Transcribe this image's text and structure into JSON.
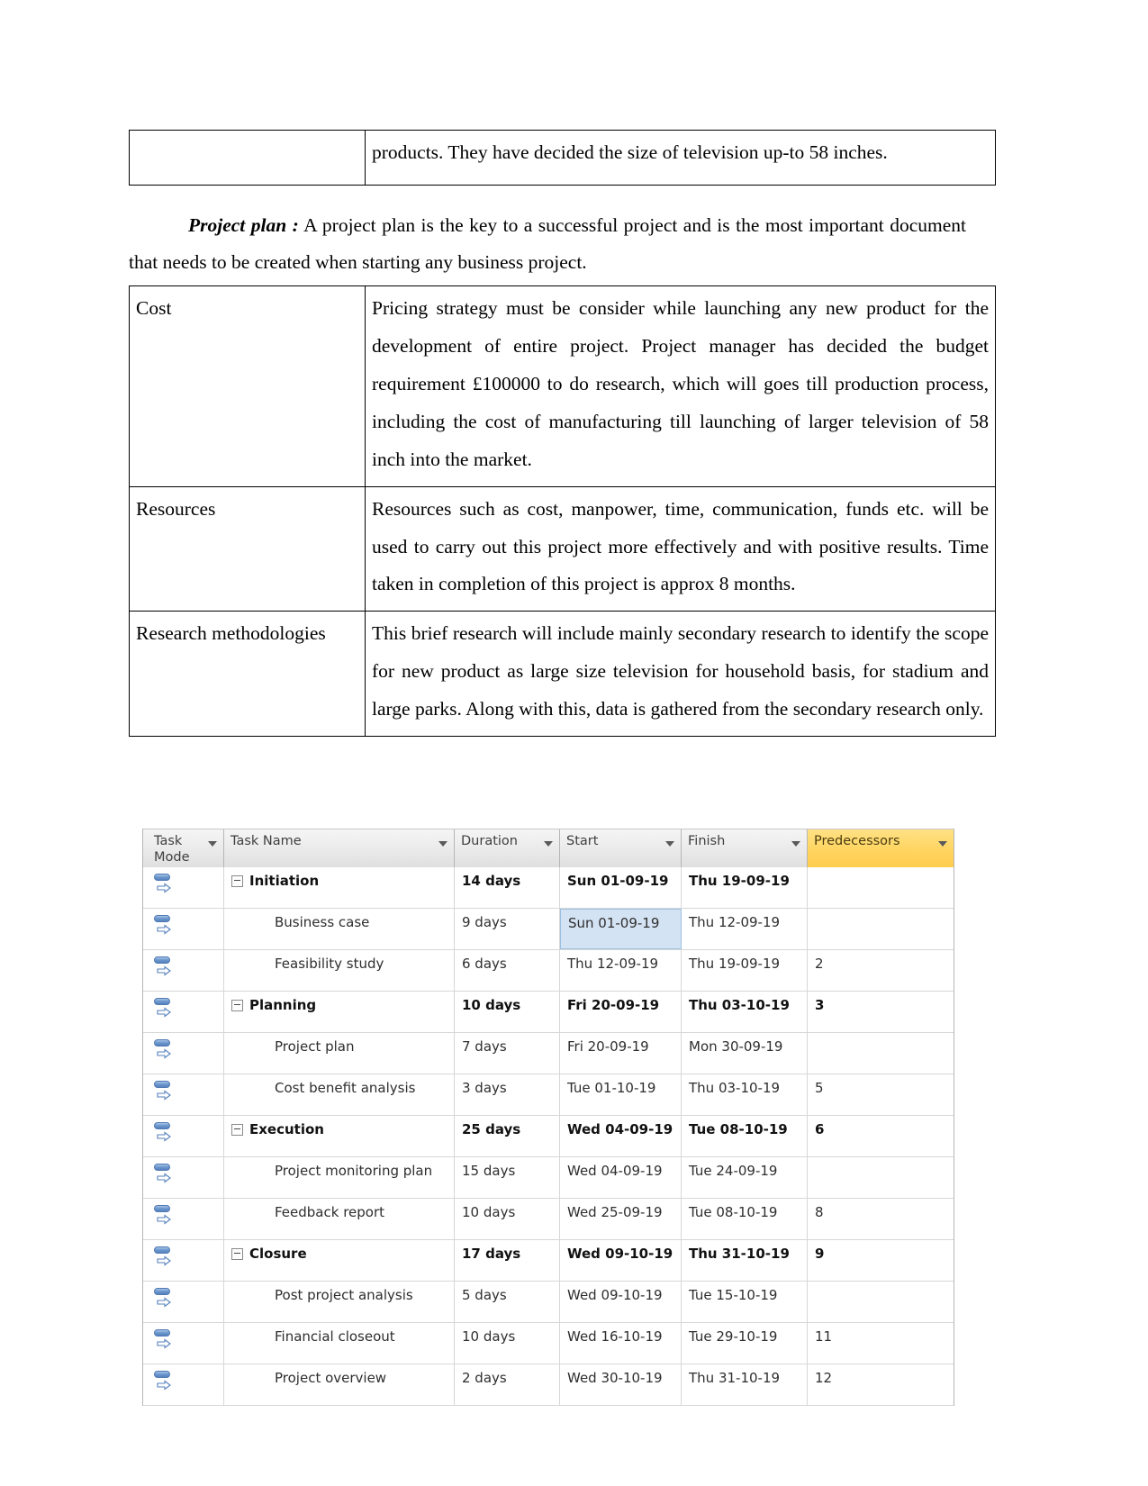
{
  "document": {
    "top_table": {
      "left_cell": "",
      "right_cell": "products. They have decided the size of television up-to 58 inches."
    },
    "intro_paragraph": {
      "heading": "Project plan :",
      "text": " A project plan is the key to a successful project and is the most important document that needs to be created when starting any business project."
    },
    "plan_table": {
      "rows": [
        {
          "label": "Cost",
          "body": "Pricing strategy must be consider while launching any new product for the development of entire project. Project manager has decided the budget requirement  £100000 to do research, which will goes till production process, including the cost of manufacturing till launching of larger television of 58 inch into the market."
        },
        {
          "label": "Resources",
          "body": "Resources such as cost, manpower, time, communication, funds etc. will be used to carry out this project more effectively and with positive results. Time taken in completion of this project is approx 8 months."
        },
        {
          "label": "Research methodologies",
          "body": "This brief research will include mainly secondary research to identify the scope for new product as large size television for household basis, for stadium and large parks. Along with this, data is gathered from the secondary research only."
        }
      ]
    }
  },
  "project_grid": {
    "columns": [
      {
        "key": "task_mode",
        "label": "Task Mode",
        "filter_icon": "chevron-down-icon",
        "highlighted": false
      },
      {
        "key": "task_name",
        "label": "Task Name",
        "filter_icon": "chevron-down-icon",
        "highlighted": false
      },
      {
        "key": "duration",
        "label": "Duration",
        "filter_icon": "chevron-down-icon",
        "highlighted": false
      },
      {
        "key": "start",
        "label": "Start",
        "filter_icon": "chevron-down-icon",
        "highlighted": false
      },
      {
        "key": "finish",
        "label": "Finish",
        "filter_icon": "chevron-down-icon",
        "highlighted": false
      },
      {
        "key": "predecessors",
        "label": "Predecessors",
        "filter_icon": "chevron-down-icon",
        "highlighted": true
      }
    ],
    "accent_color": "#ffd45e",
    "selection_color": "#d4e3f3",
    "mode_icon": "auto-schedule-icon",
    "rows": [
      {
        "task_mode": "auto-schedule-icon",
        "name": "Initiation",
        "duration": "14 days",
        "start": "Sun 01-09-19",
        "finish": "Thu 19-09-19",
        "predecessors": "",
        "summary": true,
        "level": 0,
        "selected_cell": ""
      },
      {
        "task_mode": "auto-schedule-icon",
        "name": "Business case",
        "duration": "9 days",
        "start": "Sun 01-09-19",
        "finish": "Thu 12-09-19",
        "predecessors": "",
        "summary": false,
        "level": 1,
        "selected_cell": "start"
      },
      {
        "task_mode": "auto-schedule-icon",
        "name": "Feasibility study",
        "duration": "6 days",
        "start": "Thu 12-09-19",
        "finish": "Thu 19-09-19",
        "predecessors": "2",
        "summary": false,
        "level": 1,
        "selected_cell": ""
      },
      {
        "task_mode": "auto-schedule-icon",
        "name": "Planning",
        "duration": "10 days",
        "start": "Fri 20-09-19",
        "finish": "Thu 03-10-19",
        "predecessors": "3",
        "summary": true,
        "level": 0,
        "selected_cell": ""
      },
      {
        "task_mode": "auto-schedule-icon",
        "name": "Project plan",
        "duration": "7 days",
        "start": "Fri 20-09-19",
        "finish": "Mon 30-09-19",
        "predecessors": "",
        "summary": false,
        "level": 1,
        "selected_cell": ""
      },
      {
        "task_mode": "auto-schedule-icon",
        "name": "Cost benefit analysis",
        "duration": "3 days",
        "start": "Tue 01-10-19",
        "finish": "Thu 03-10-19",
        "predecessors": "5",
        "summary": false,
        "level": 1,
        "selected_cell": ""
      },
      {
        "task_mode": "auto-schedule-icon",
        "name": "Execution",
        "duration": "25 days",
        "start": "Wed 04-09-19",
        "finish": "Tue 08-10-19",
        "predecessors": "6",
        "summary": true,
        "level": 0,
        "selected_cell": ""
      },
      {
        "task_mode": "auto-schedule-icon",
        "name": "Project monitoring plan",
        "duration": "15 days",
        "start": "Wed 04-09-19",
        "finish": "Tue 24-09-19",
        "predecessors": "",
        "summary": false,
        "level": 1,
        "selected_cell": ""
      },
      {
        "task_mode": "auto-schedule-icon",
        "name": "Feedback report",
        "duration": "10 days",
        "start": "Wed 25-09-19",
        "finish": "Tue 08-10-19",
        "predecessors": "8",
        "summary": false,
        "level": 1,
        "selected_cell": ""
      },
      {
        "task_mode": "auto-schedule-icon",
        "name": "Closure",
        "duration": "17 days",
        "start": "Wed 09-10-19",
        "finish": "Thu 31-10-19",
        "predecessors": "9",
        "summary": true,
        "level": 0,
        "selected_cell": ""
      },
      {
        "task_mode": "auto-schedule-icon",
        "name": "Post project analysis",
        "duration": "5 days",
        "start": "Wed 09-10-19",
        "finish": "Tue 15-10-19",
        "predecessors": "",
        "summary": false,
        "level": 1,
        "selected_cell": ""
      },
      {
        "task_mode": "auto-schedule-icon",
        "name": "Financial closeout",
        "duration": "10 days",
        "start": "Wed 16-10-19",
        "finish": "Tue 29-10-19",
        "predecessors": "11",
        "summary": false,
        "level": 1,
        "selected_cell": ""
      },
      {
        "task_mode": "auto-schedule-icon",
        "name": "Project overview",
        "duration": "2 days",
        "start": "Wed 30-10-19",
        "finish": "Thu 31-10-19",
        "predecessors": "12",
        "summary": false,
        "level": 1,
        "selected_cell": ""
      }
    ]
  }
}
